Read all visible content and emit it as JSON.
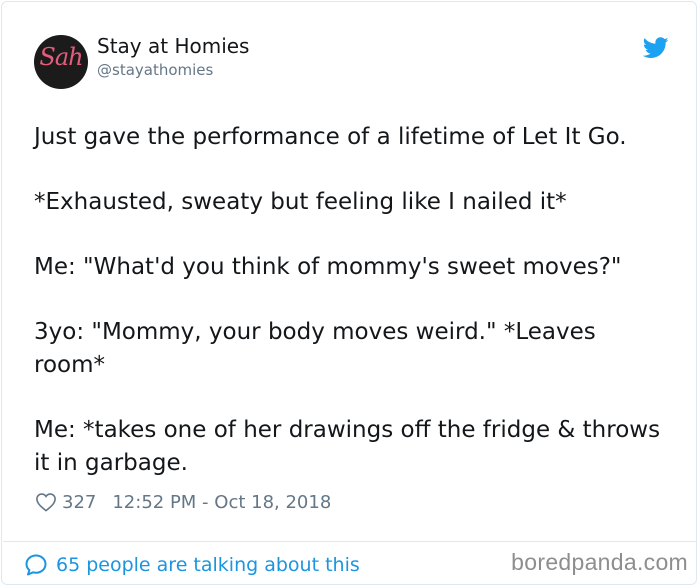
{
  "tweet": {
    "avatar_text": "Sah",
    "display_name": "Stay at Homies",
    "handle": "@stayathomies",
    "paragraphs": [
      "Just gave the performance of a lifetime of Let It Go.",
      "*Exhausted, sweaty but feeling like I nailed it*",
      "Me: \"What'd you think of mommy's sweet moves?\"",
      "3yo: \"Mommy, your body moves weird.\" *Leaves room*",
      "Me: *takes one of her drawings off the fridge & throws it in garbage."
    ],
    "likes": "327",
    "timestamp": "12:52 PM - Oct 18, 2018",
    "talking": "65 people are talking about this"
  },
  "watermark": "boredpanda.com",
  "colors": {
    "twitter_blue": "#1da1f2",
    "link_blue": "#1b95e0",
    "text": "#14171a",
    "muted": "#657786",
    "avatar_bg": "#1b1b1b",
    "avatar_text": "#e35d7a"
  },
  "icons": {
    "brand": "twitter-bird-icon",
    "like": "heart-icon",
    "reply": "speech-bubble-icon"
  }
}
